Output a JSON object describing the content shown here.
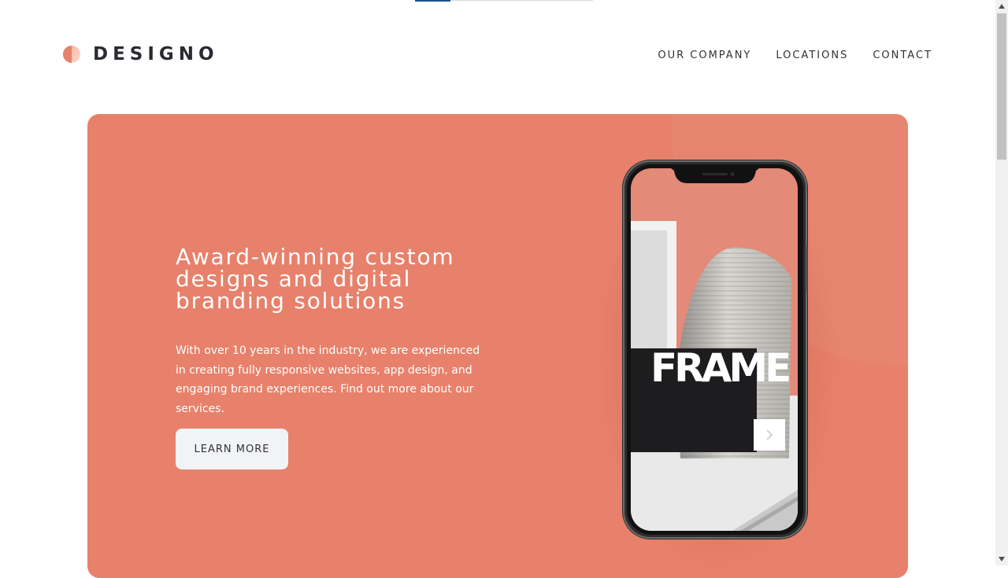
{
  "brand": {
    "name": "DESIGNO",
    "colors": {
      "accent": "#e7816b",
      "dark": "#1d1c1e"
    }
  },
  "nav": {
    "items": [
      {
        "label": "OUR COMPANY"
      },
      {
        "label": "LOCATIONS"
      },
      {
        "label": "CONTACT"
      }
    ]
  },
  "hero": {
    "title": "Award-winning custom designs and digital branding solutions",
    "text": "With over 10 years in the industry, we are experienced in creating fully responsive websites, app design, and engaging brand experiences. Find out more about our services.",
    "cta_label": "LEARN MORE",
    "phone_screen_word": "FRAME",
    "next_icon": "chevron-right-icon"
  },
  "scrollbar": {
    "up_icon": "triangle-up-icon",
    "down_icon": "triangle-down-icon"
  }
}
